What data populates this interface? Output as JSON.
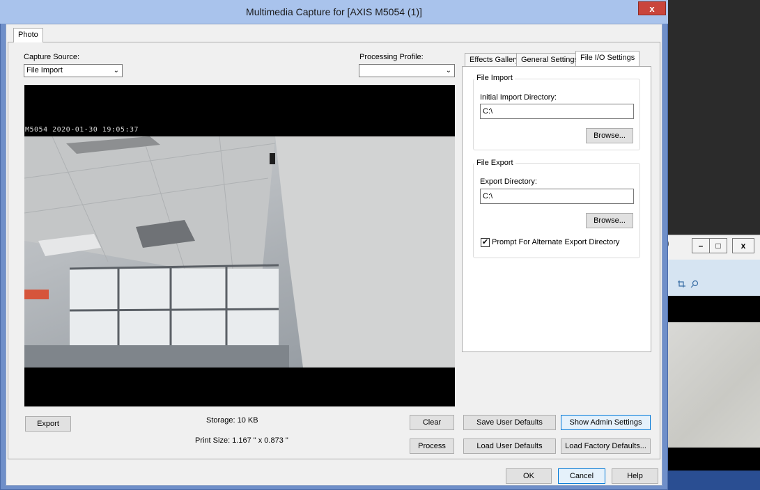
{
  "window": {
    "title": "Multimedia Capture for [AXIS M5054 (1)]",
    "close_glyph": "x"
  },
  "tabs": {
    "photo": "Photo"
  },
  "capture_source": {
    "label": "Capture Source:",
    "value": "File Import",
    "arrow": "⌄"
  },
  "processing_profile": {
    "label": "Processing Profile:",
    "value": "",
    "arrow": "⌄"
  },
  "preview": {
    "osd_text": "M5054 2020-01-30 19:05:37"
  },
  "info": {
    "storage": "Storage: 10 KB",
    "print_size": "Print Size: 1.167 \" x 0.873 \""
  },
  "buttons": {
    "export": "Export",
    "clear": "Clear",
    "process": "Process",
    "save_user_defaults": "Save User Defaults",
    "show_admin_settings": "Show Admin Settings",
    "load_user_defaults": "Load User Defaults",
    "load_factory_defaults": "Load Factory Defaults...",
    "ok": "OK",
    "cancel": "Cancel",
    "help": "Help"
  },
  "settings_tabs": {
    "effects_gallery": "Effects Gallery",
    "general_settings": "General Settings",
    "file_io_settings": "File I/O Settings"
  },
  "file_import": {
    "group_title": "File Import",
    "dir_label": "Initial Import Directory:",
    "dir_value": "C:\\",
    "browse": "Browse..."
  },
  "file_export": {
    "group_title": "File Export",
    "dir_label": "Export Directory:",
    "dir_value": "C:\\",
    "browse": "Browse...",
    "prompt_label": "Prompt For Alternate Export Directory",
    "prompt_checked": true,
    "check_glyph": "✔"
  },
  "background_window": {
    "minimize_glyph": "–",
    "restore_glyph": "□",
    "close_glyph": "x",
    "toolbar_icons": [
      "crop-icon",
      "search-icon"
    ],
    "colors": {
      "toolbar": "#d6e4f2",
      "taskbar": "#2a4e92"
    }
  },
  "colors": {
    "title_bar": "#a9c3ec",
    "close_button": "#c9453c",
    "focus_border": "#0078d7"
  }
}
